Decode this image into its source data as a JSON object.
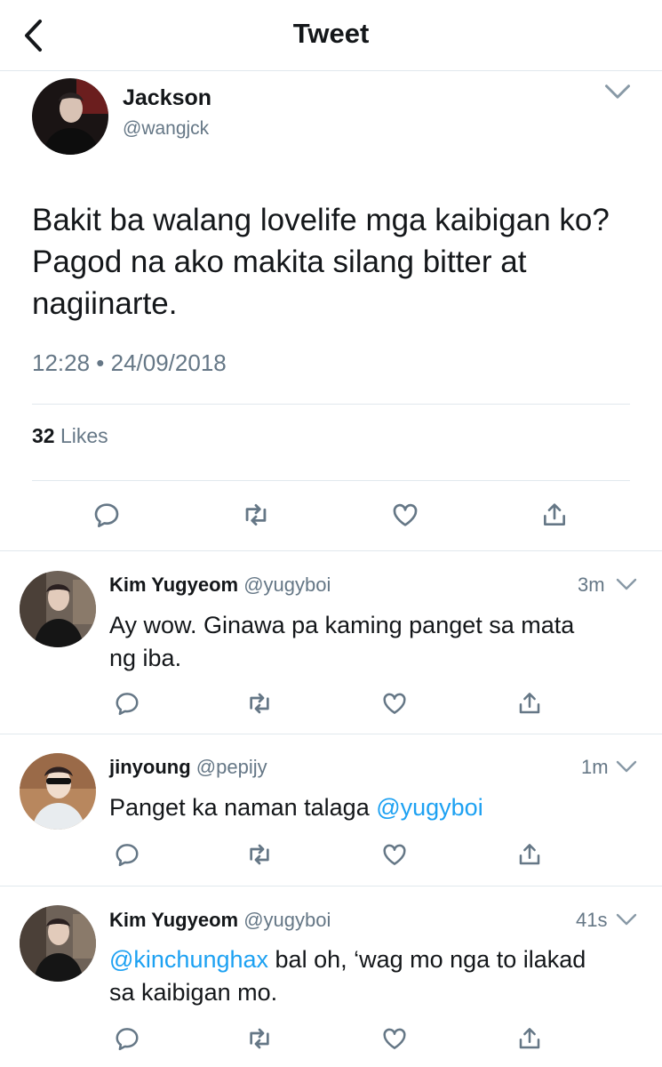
{
  "header": {
    "title": "Tweet"
  },
  "main_tweet": {
    "name": "Jackson",
    "handle": "@wangjck",
    "text": "Bakit ba walang lovelife mga kaibigan ko? Pagod na ako makita silang bitter at nagiinarte.",
    "timestamp": "12:28 • 24/09/2018",
    "likes_count": "32",
    "likes_label": "Likes"
  },
  "replies": [
    {
      "name": "Kim Yugyeom",
      "handle": "@yugyboi",
      "time": "3m",
      "text_1": "Ay wow. Ginawa pa kaming panget sa mata",
      "text_2": "ng iba."
    },
    {
      "name": "jinyoung",
      "handle": "@pepijy",
      "time": "1m",
      "text": "Panget ka naman talaga ",
      "mention": "@yugyboi"
    },
    {
      "name": "Kim Yugyeom",
      "handle": "@yugyboi",
      "time": "41s",
      "mention": "@kinchunghax",
      "text_1": " bal oh, ‘wag mo nga to ilakad",
      "text_2": "sa kaibigan mo."
    }
  ],
  "colors": {
    "link": "#1da1f2",
    "icon_gray": "#657786",
    "divider": "#e1e8ed"
  }
}
